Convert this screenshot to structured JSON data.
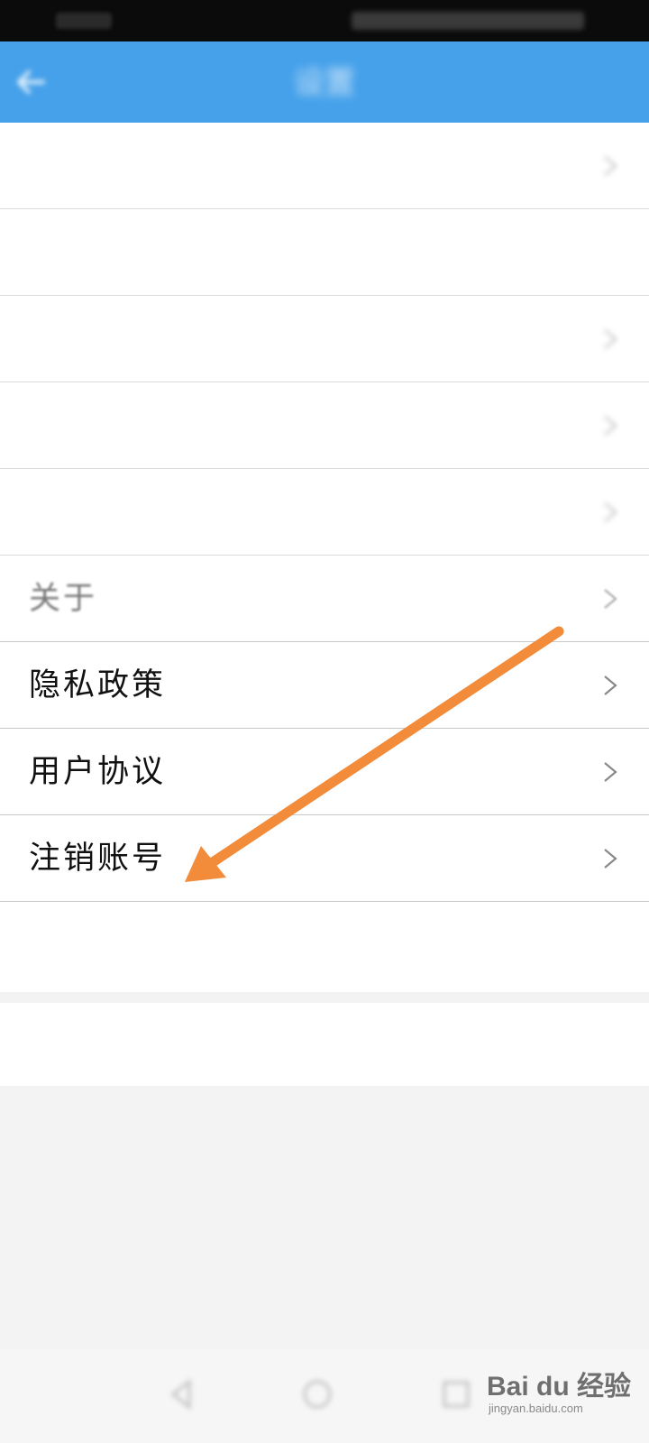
{
  "status_bar": {},
  "top_bar": {
    "back_icon": "back-arrow-icon",
    "title": "设置"
  },
  "settings": {
    "items": [
      {
        "label": "",
        "chevron": "chevron-right-icon"
      },
      {
        "label": ""
      },
      {
        "label": "",
        "chevron": "chevron-right-icon"
      },
      {
        "label": "",
        "chevron": "chevron-right-icon"
      },
      {
        "label": "",
        "chevron": "chevron-right-icon"
      },
      {
        "label": "关于",
        "chevron": "chevron-right-icon"
      },
      {
        "label": "隐私政策",
        "chevron": "chevron-right-icon"
      },
      {
        "label": "用户协议",
        "chevron": "chevron-right-icon"
      },
      {
        "label": "注销账号",
        "chevron": "chevron-right-icon"
      }
    ],
    "wechat_row": "",
    "logout": ""
  },
  "annotation": {
    "arrow_color": "#f28b3a",
    "points_to": "注销账号"
  },
  "navbar": {
    "icons": [
      "nav-back-icon",
      "nav-home-icon",
      "nav-recents-icon"
    ]
  },
  "watermark": {
    "main": "Bai du 经验",
    "sub": "jingyan.baidu.com"
  },
  "colors": {
    "accent": "#46a1ea",
    "status_bar": "#0b0b0b",
    "arrow": "#f28b3a"
  }
}
